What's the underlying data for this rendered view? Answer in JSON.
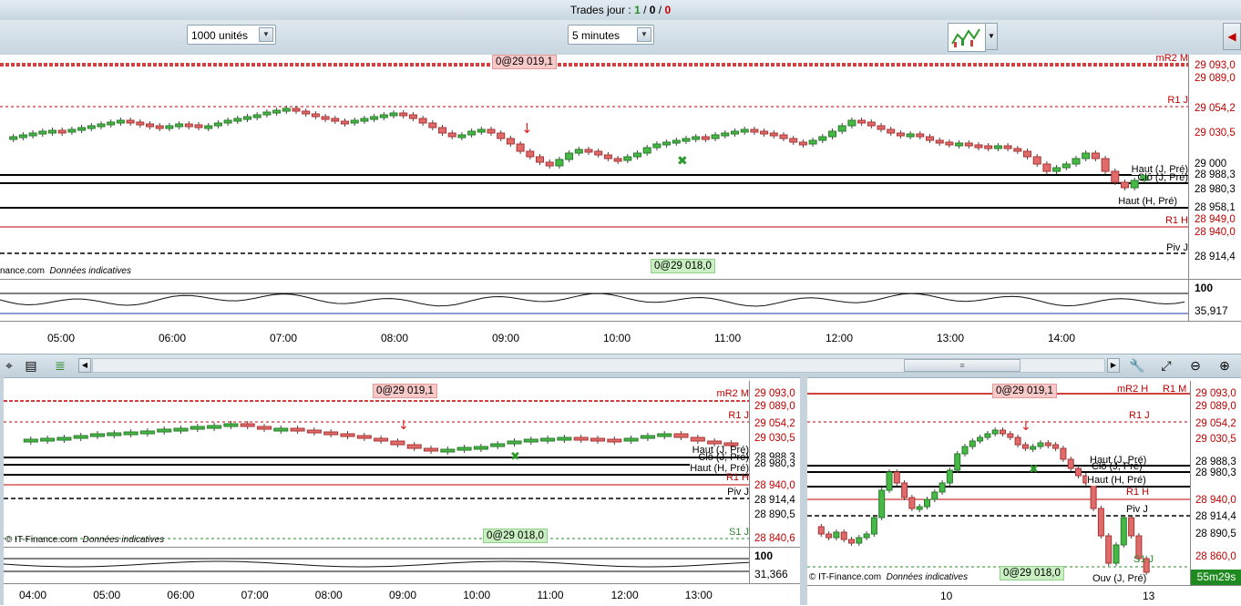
{
  "header": {
    "title_prefix": "Trades jour : ",
    "title_a": "1",
    "title_sep1": " / ",
    "title_b": "0",
    "title_sep2": " / ",
    "title_c": "0"
  },
  "toolbar": {
    "quantity_select": "1000 unités",
    "interval_select": "5 minutes"
  },
  "main_chart": {
    "order_tag_top": "0@29 019,1",
    "order_tag_bottom": "0@29 018,0",
    "credit": "nance.com",
    "credit_italic": "Données indicatives",
    "levels": [
      {
        "name": "mR2 M",
        "price": "29 093,0"
      },
      {
        "name": "",
        "price": "29 089,0"
      },
      {
        "name": "R1 J",
        "price": "29 054,2"
      },
      {
        "name": "",
        "price": "29 030,5"
      },
      {
        "name": "",
        "price": "29 000"
      },
      {
        "name": "Haut (J, Pré)",
        "price": "28 988,3"
      },
      {
        "name": "Clô (J, Pré)",
        "price": "28 980,3"
      },
      {
        "name": "Haut (H, Pré)",
        "price": "28 958,1"
      },
      {
        "name": "R1 H",
        "price": "28 949,0"
      },
      {
        "name": "",
        "price": "28 940,0"
      },
      {
        "name": "Piv J",
        "price": "28 914,4"
      }
    ],
    "indicator_max": "100",
    "indicator_value": "35,917",
    "hours": [
      "05:00",
      "06:00",
      "07:00",
      "08:00",
      "09:00",
      "10:00",
      "11:00",
      "12:00",
      "13:00",
      "14:00"
    ]
  },
  "bottom_left_chart": {
    "order_tag_top": "0@29 019,1",
    "order_tag_bottom": "0@29 018,0",
    "credit": "© IT-Finance.com",
    "credit_italic": "Données indicatives",
    "levels": [
      {
        "name": "mR2 M",
        "price": "29 093,0"
      },
      {
        "name": "",
        "price": "29 089,0"
      },
      {
        "name": "R1 J",
        "price": "29 054,2"
      },
      {
        "name": "",
        "price": "29 030,5"
      },
      {
        "name": "Haut (J, Pré)",
        "price": "28 988,3"
      },
      {
        "name": "Clô (J, Pré)",
        "price": "28 980,3"
      },
      {
        "name": "Haut (H, Pré)",
        "price": ""
      },
      {
        "name": "R1 H",
        "price": "28 940,0"
      },
      {
        "name": "Piv J",
        "price": "28 914,4"
      },
      {
        "name": "",
        "price": "28 890,5"
      },
      {
        "name": "S1 J",
        "price": "28 840,6"
      }
    ],
    "indicator_max": "100",
    "indicator_value": "31,366",
    "hours": [
      "04:00",
      "05:00",
      "06:00",
      "07:00",
      "08:00",
      "09:00",
      "10:00",
      "11:00",
      "12:00",
      "13:00"
    ]
  },
  "bottom_right_chart": {
    "order_tag_top": "0@29 019,1",
    "order_tag_bottom": "0@29 018,0",
    "credit": "© IT-Finance.com",
    "credit_italic": "Données indicatives",
    "levels": [
      {
        "name": "mR2 H",
        "price": "29 093,0"
      },
      {
        "name": "R1 M",
        "price": "29 089,0"
      },
      {
        "name": "R1 J",
        "price": "29 054,2"
      },
      {
        "name": "",
        "price": "29 030,5"
      },
      {
        "name": "Haut (J, Pré)",
        "price": "28 988,3"
      },
      {
        "name": "Clô (J, Pré)",
        "price": "28 980,3"
      },
      {
        "name": "Haut (H, Pré)",
        "price": ""
      },
      {
        "name": "R1 H",
        "price": "28 940,0"
      },
      {
        "name": "Piv J",
        "price": "28 914,4"
      },
      {
        "name": "",
        "price": "28 890,5"
      },
      {
        "name": "S1 J",
        "price": "28 860,0"
      },
      {
        "name": "Ouv (J, Pré)",
        "price": ""
      }
    ],
    "timer": "55m29s",
    "days": [
      "10",
      "13"
    ]
  }
}
